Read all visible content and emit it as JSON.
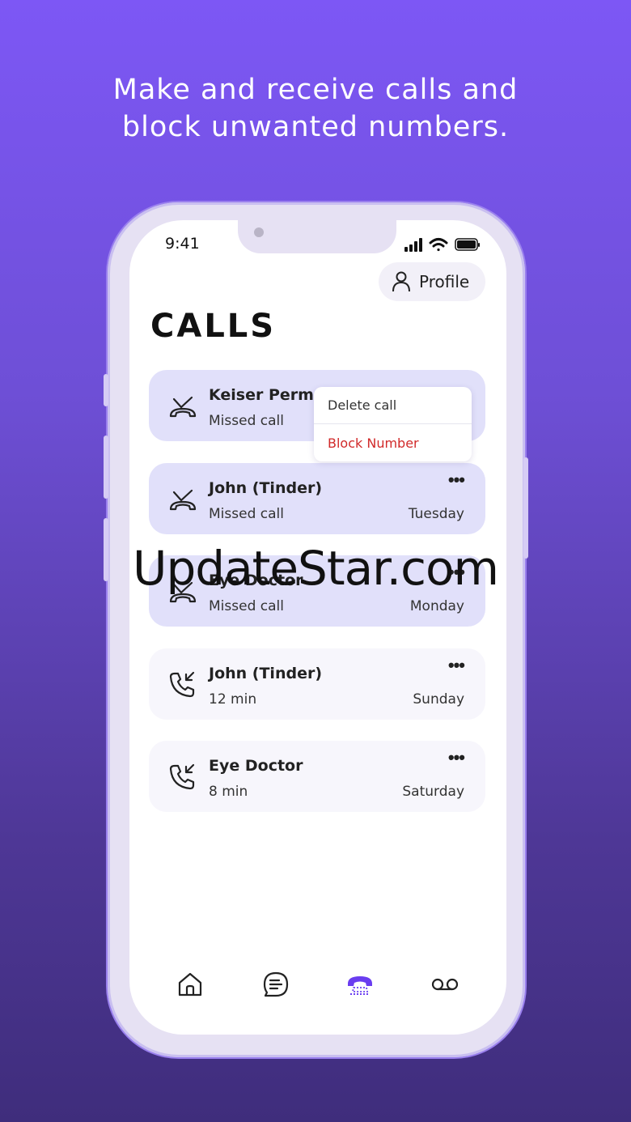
{
  "headline": {
    "line1": "Make and receive calls and",
    "line2": "block unwanted numbers."
  },
  "status_bar": {
    "time": "9:41"
  },
  "header": {
    "profile_label": "Profile",
    "title": "CALLS"
  },
  "calls": [
    {
      "name": "Keiser Perma",
      "detail": "Missed call",
      "day": "",
      "type": "missed"
    },
    {
      "name": "John (Tinder)",
      "detail": "Missed call",
      "day": "Tuesday",
      "type": "missed"
    },
    {
      "name": "Eye Doctor",
      "detail": "Missed call",
      "day": "Monday",
      "type": "missed"
    },
    {
      "name": "John (Tinder)",
      "detail": "12 min",
      "day": "Sunday",
      "type": "answered"
    },
    {
      "name": "Eye Doctor",
      "detail": "8 min",
      "day": "Saturday",
      "type": "answered"
    }
  ],
  "more_glyph": "•••",
  "context_menu": {
    "delete_label": "Delete call",
    "block_label": "Block Number"
  },
  "watermark": "UpdateStar.com",
  "tabbar": {
    "items": [
      {
        "icon": "home-icon",
        "active": false
      },
      {
        "icon": "messages-icon",
        "active": false
      },
      {
        "icon": "phone-icon",
        "active": true
      },
      {
        "icon": "voicemail-icon",
        "active": false
      }
    ]
  },
  "colors": {
    "accent": "#6a3df0",
    "danger": "#d12a2a",
    "missed_card": "#e1e0fa",
    "answered_card": "#f7f6fc"
  }
}
